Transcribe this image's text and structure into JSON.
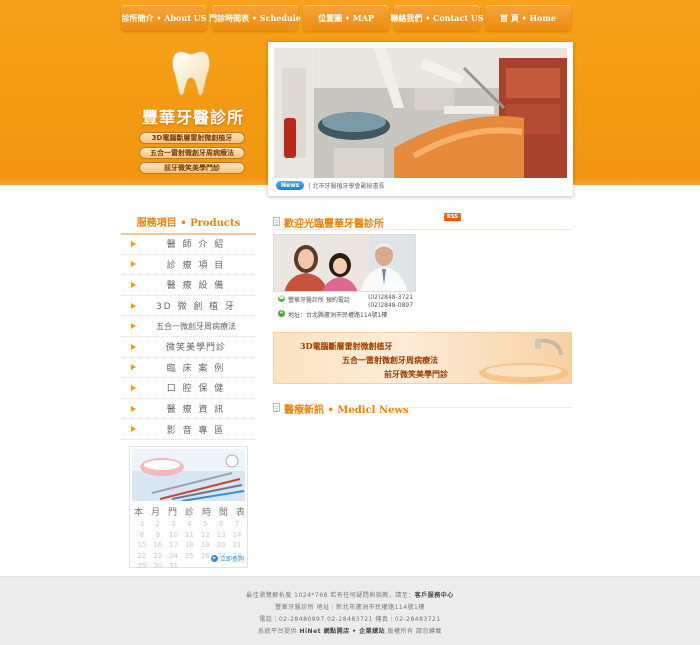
{
  "nav": [
    {
      "label": "診所簡介 • About US"
    },
    {
      "label": "門診時間表 • Schedule"
    },
    {
      "label": "位置圖 • MAP"
    },
    {
      "label": "聯絡我們 • Contact US"
    },
    {
      "label": "首 頁 • Home"
    }
  ],
  "clinic": {
    "name": "豐華牙醫診所"
  },
  "services": [
    {
      "label": "3D電腦斷層雷射微創植牙"
    },
    {
      "label": "五合一雷射微創牙周病療法"
    },
    {
      "label": "前牙微笑美學門診"
    }
  ],
  "news_ticker": {
    "badge": "News",
    "text": "( 北市牙醫植牙學會副秘書長"
  },
  "sidebar": {
    "title": "服務項目 • Products",
    "items": [
      {
        "label": "醫 師 介 紹"
      },
      {
        "label": "診 療 項 目"
      },
      {
        "label": "醫 療 設 備"
      },
      {
        "label": "3D 微 創 植 牙"
      },
      {
        "label": "五合一微創牙周病療法"
      },
      {
        "label": "微笑美學門診"
      },
      {
        "label": "臨 床 案 例"
      },
      {
        "label": "口 腔 保 健"
      },
      {
        "label": "醫 療 資 訊"
      },
      {
        "label": "影 音 專 區"
      }
    ]
  },
  "calendar": {
    "headers": [
      "本",
      "月",
      "門",
      "診",
      "時",
      "間",
      "表"
    ],
    "days": [
      "1",
      "2",
      "3",
      "4",
      "5",
      "6",
      "7",
      "8",
      "9",
      "10",
      "11",
      "12",
      "13",
      "14",
      "15",
      "16",
      "17",
      "18",
      "19",
      "20",
      "21",
      "22",
      "23",
      "24",
      "25",
      "26",
      "27",
      "28",
      "29",
      "30",
      "31"
    ],
    "link": "立即查詢"
  },
  "welcome": {
    "title": "歡迎光臨豐華牙醫診所",
    "rss": "RSS",
    "caption": "院長照片",
    "booking_label": "豐華牙醫診所  預約電話",
    "address": "地址：台北縣蘆洲市民權路114號1樓",
    "phone1": "(02)2848-3721",
    "phone2": "(02)2848-0897"
  },
  "banner": {
    "line1": "3D電腦斷層雷射微創植牙",
    "line2": "五合一雷射微創牙周病療法",
    "line3": "前牙微笑美學門診"
  },
  "news": {
    "title": "醫療新訊 • Medicl News"
  },
  "footer": {
    "line1": "最佳瀏覽解析度 1024*768  若有任何疑問與指教，請至：",
    "line1_link": "客戶服務中心",
    "line2": "豐華牙醫診所  地址｜新北市蘆洲市民權路114號1樓",
    "line3": "電話｜02-28480897.02-28483721  傳真｜02-28483721",
    "line4": "系統平台提供 ",
    "line4_link": "HiNet 網點開店 • 企業總站",
    "line4_end": "  版權所有  請勿轉載"
  },
  "colors": {
    "accent": "#f39a12",
    "title": "#e8840d"
  }
}
